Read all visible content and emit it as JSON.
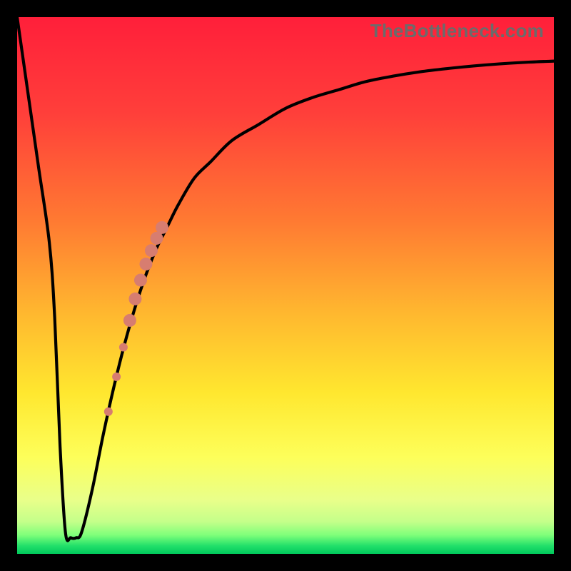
{
  "watermark": "TheBottleneck.com",
  "colors": {
    "frame": "#000000",
    "curve": "#000000",
    "dots": "#d77d70",
    "gradient_stops": [
      {
        "offset": 0.0,
        "color": "#ff1f3a"
      },
      {
        "offset": 0.18,
        "color": "#ff3f3a"
      },
      {
        "offset": 0.38,
        "color": "#ff7a32"
      },
      {
        "offset": 0.55,
        "color": "#ffb72f"
      },
      {
        "offset": 0.7,
        "color": "#ffe72f"
      },
      {
        "offset": 0.82,
        "color": "#fdff5a"
      },
      {
        "offset": 0.9,
        "color": "#e9ff8a"
      },
      {
        "offset": 0.94,
        "color": "#c4ff8a"
      },
      {
        "offset": 0.965,
        "color": "#7fff7a"
      },
      {
        "offset": 0.985,
        "color": "#22e06a"
      },
      {
        "offset": 1.0,
        "color": "#00c85c"
      }
    ]
  },
  "chart_data": {
    "type": "line",
    "title": "",
    "xlabel": "",
    "ylabel": "",
    "xlim": [
      0,
      100
    ],
    "ylim": [
      0,
      100
    ],
    "series": [
      {
        "name": "bottleneck-curve",
        "x": [
          0,
          2,
          4,
          6,
          7,
          8,
          9,
          10,
          11,
          12,
          14,
          16,
          18,
          20,
          22,
          24,
          26,
          28,
          30,
          33,
          36,
          40,
          45,
          50,
          55,
          60,
          65,
          70,
          75,
          80,
          85,
          90,
          95,
          100
        ],
        "y": [
          100,
          86,
          72,
          58,
          44,
          20,
          4,
          3,
          3,
          4,
          12,
          22,
          31,
          39,
          46,
          52,
          57,
          61,
          65,
          70,
          73,
          77,
          80,
          83,
          85,
          86.5,
          88,
          89,
          89.8,
          90.4,
          90.9,
          91.3,
          91.6,
          91.8
        ]
      }
    ],
    "dots": {
      "name": "highlight-dots",
      "points": [
        {
          "x": 17.0,
          "y": 26.5,
          "r": 6
        },
        {
          "x": 18.5,
          "y": 33.0,
          "r": 6
        },
        {
          "x": 19.8,
          "y": 38.5,
          "r": 6
        },
        {
          "x": 21.0,
          "y": 43.5,
          "r": 9
        },
        {
          "x": 22.0,
          "y": 47.5,
          "r": 9
        },
        {
          "x": 23.0,
          "y": 51.0,
          "r": 9
        },
        {
          "x": 24.0,
          "y": 54.0,
          "r": 9
        },
        {
          "x": 25.0,
          "y": 56.5,
          "r": 9
        },
        {
          "x": 26.0,
          "y": 58.8,
          "r": 9
        },
        {
          "x": 27.0,
          "y": 60.8,
          "r": 9
        }
      ]
    }
  }
}
